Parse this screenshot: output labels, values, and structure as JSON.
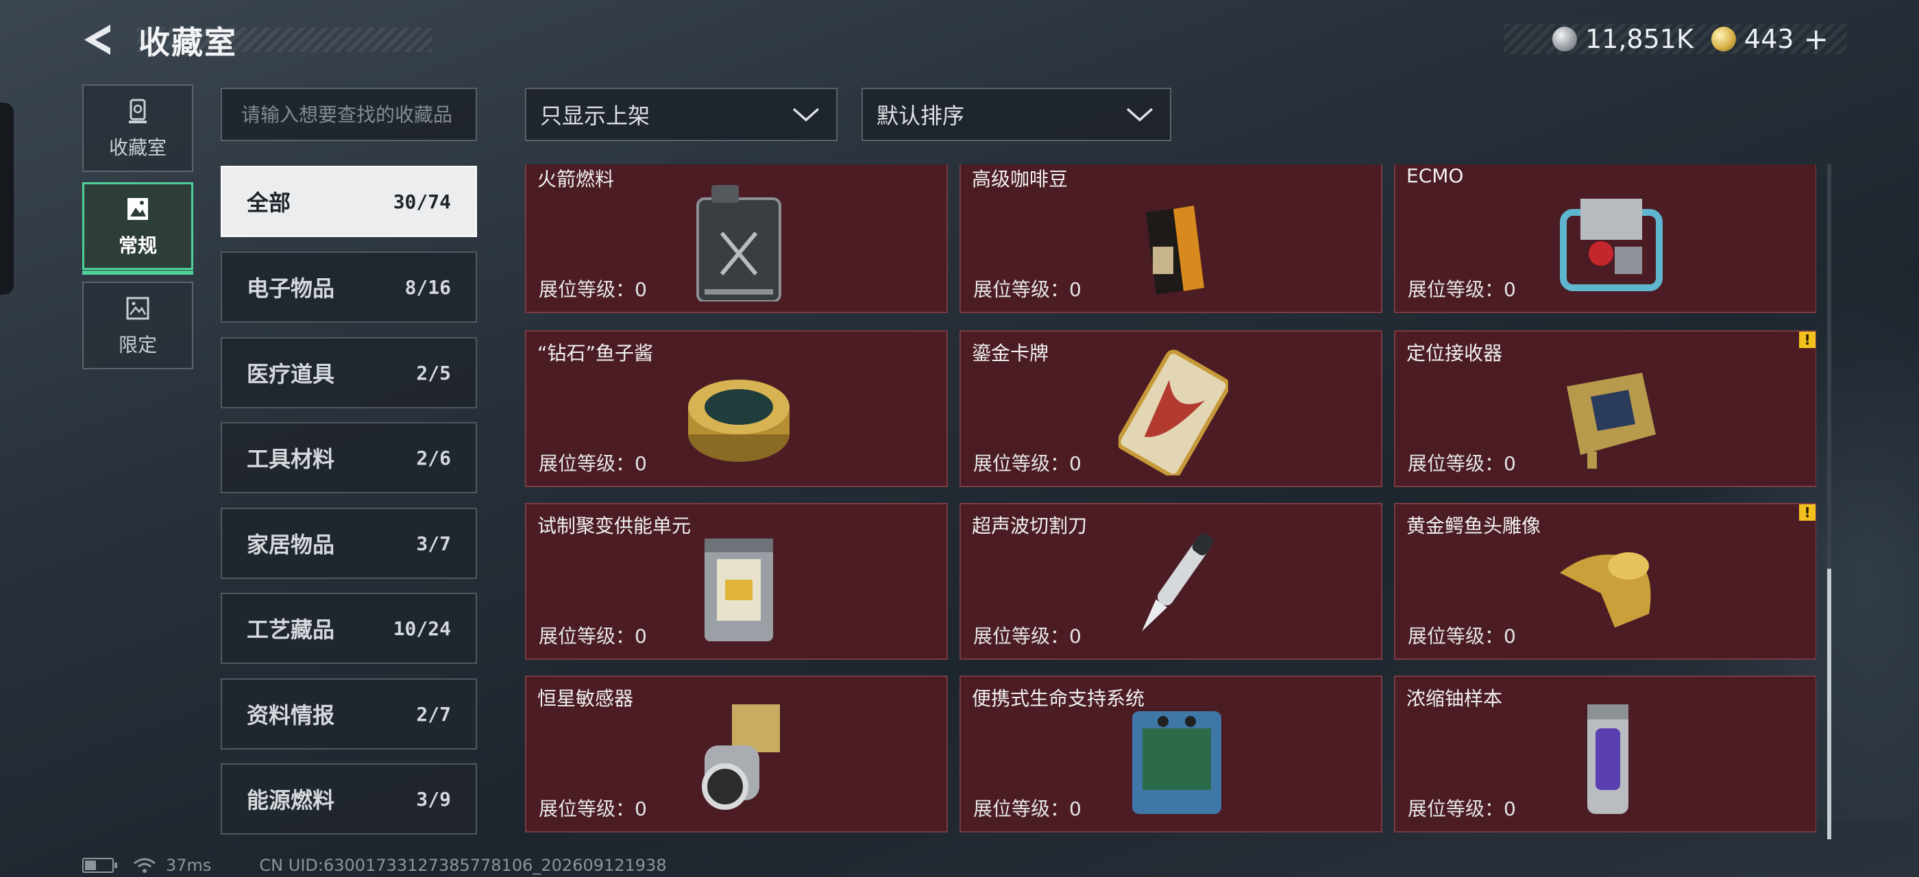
{
  "header": {
    "title": "收藏室",
    "currency_silver": "11,851K",
    "currency_gold": "443"
  },
  "nav": [
    {
      "label": "收藏室",
      "icon": "trophy-icon"
    },
    {
      "label": "常规",
      "icon": "picture-icon"
    },
    {
      "label": "限定",
      "icon": "landscape-icon"
    }
  ],
  "search": {
    "placeholder": "请输入想要查找的收藏品",
    "value": ""
  },
  "filters": {
    "display": "只显示上架",
    "sort": "默认排序"
  },
  "categories": [
    {
      "name": "全部",
      "count": "30/74"
    },
    {
      "name": "电子物品",
      "count": "8/16"
    },
    {
      "name": "医疗道具",
      "count": "2/5"
    },
    {
      "name": "工具材料",
      "count": "2/6"
    },
    {
      "name": "家居物品",
      "count": "3/7"
    },
    {
      "name": "工艺藏品",
      "count": "10/24"
    },
    {
      "name": "资料情报",
      "count": "2/7"
    },
    {
      "name": "能源燃料",
      "count": "3/9"
    }
  ],
  "level_label": "展位等级：0",
  "items": [
    {
      "name": "火箭燃料",
      "icon": "fuel-canister-icon",
      "warn": false
    },
    {
      "name": "高级咖啡豆",
      "icon": "coffee-bag-icon",
      "warn": false
    },
    {
      "name": "ECMO",
      "icon": "ecmo-machine-icon",
      "warn": false
    },
    {
      "name": "“钻石”鱼子酱",
      "icon": "caviar-tin-icon",
      "warn": false
    },
    {
      "name": "鎏金卡牌",
      "icon": "gilded-card-icon",
      "warn": false
    },
    {
      "name": "定位接收器",
      "icon": "receiver-device-icon",
      "warn": true
    },
    {
      "name": "试制聚变供能单元",
      "icon": "fusion-cell-icon",
      "warn": false
    },
    {
      "name": "超声波切割刀",
      "icon": "ultrasonic-knife-icon",
      "warn": false
    },
    {
      "name": "黄金鳄鱼头雕像",
      "icon": "gold-crocodile-icon",
      "warn": true
    },
    {
      "name": "恒星敏感器",
      "icon": "star-sensor-icon",
      "warn": false
    },
    {
      "name": "便携式生命支持系统",
      "icon": "life-support-icon",
      "warn": false
    },
    {
      "name": "浓缩铀样本",
      "icon": "uranium-capsule-icon",
      "warn": false
    }
  ],
  "warn_mark": "!",
  "footer": {
    "ping": "37ms",
    "uid": "CN UID:6300173312738577810­6_202609121938"
  },
  "colors": {
    "accent": "#4fd29a",
    "card_bg": "#4b1c23",
    "warning": "#f3c11e"
  }
}
